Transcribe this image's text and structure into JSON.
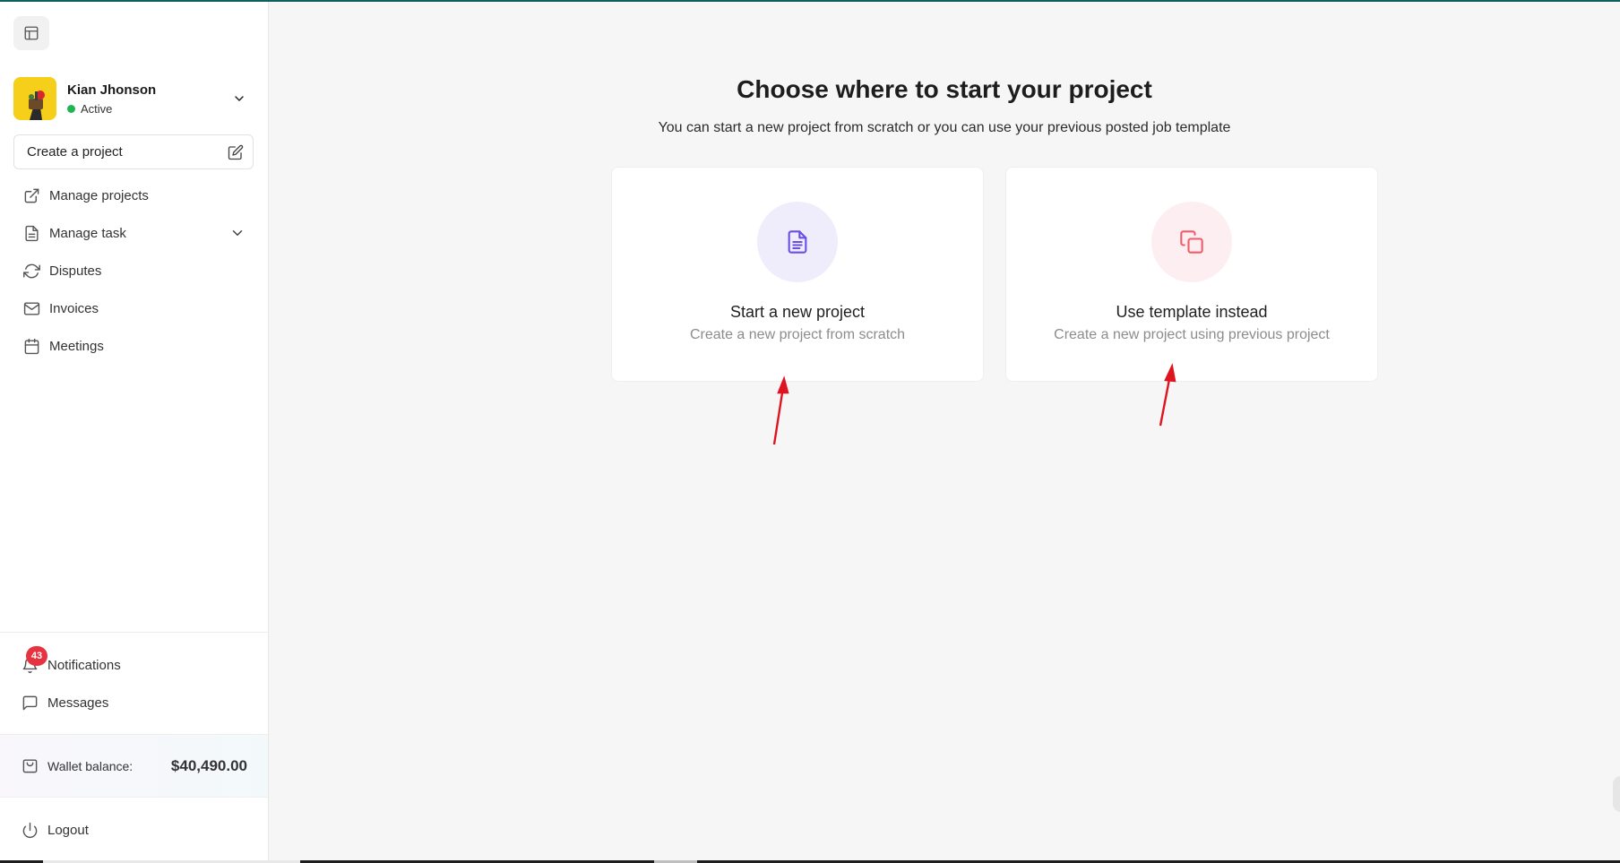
{
  "user": {
    "name": "Kian Jhonson",
    "status": "Active"
  },
  "sidebar": {
    "create_label": "Create a project",
    "items": [
      {
        "label": "Manage projects",
        "icon": "external-link-icon"
      },
      {
        "label": "Manage task",
        "icon": "document-icon"
      },
      {
        "label": "Disputes",
        "icon": "refresh-icon"
      },
      {
        "label": "Invoices",
        "icon": "mail-icon"
      },
      {
        "label": "Meetings",
        "icon": "calendar-icon"
      }
    ],
    "notifications_label": "Notifications",
    "notifications_count": "43",
    "messages_label": "Messages",
    "wallet_label": "Wallet balance:",
    "wallet_amount": "$40,490.00",
    "logout_label": "Logout"
  },
  "main": {
    "title": "Choose where to start your project",
    "subtitle": "You can start a new project from scratch or you can use your previous posted job template",
    "cards": [
      {
        "title": "Start a new project",
        "description": "Create a new project from scratch",
        "icon": "file-text-icon"
      },
      {
        "title": "Use template instead",
        "description": "Create a new project using previous project",
        "icon": "copy-icon"
      }
    ]
  },
  "colors": {
    "accent_purple": "#6b4fe0",
    "accent_pink": "#f05c6a",
    "status_green": "#1fb553",
    "badge_red": "#e6333f",
    "arrow_red": "#e0141e"
  }
}
